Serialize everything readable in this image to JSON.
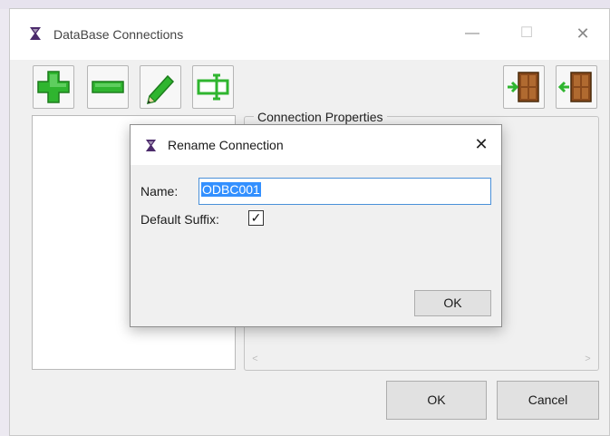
{
  "window": {
    "title": "DataBase Connections",
    "minimize_glyph": "—",
    "maximize_glyph": "☐",
    "close_glyph": "✕"
  },
  "toolbar": {
    "add_icon": "plus-icon",
    "remove_icon": "minus-icon",
    "edit_icon": "pencil-icon",
    "rename_icon": "rename-field-icon",
    "import_icon": "door-enter-icon",
    "export_icon": "door-exit-icon"
  },
  "properties": {
    "group_label": "Connection Properties",
    "scroll_left": "<",
    "scroll_right": ">"
  },
  "buttons": {
    "ok": "OK",
    "cancel": "Cancel"
  },
  "dialog": {
    "title": "Rename Connection",
    "close_glyph": "✕",
    "name_label": "Name:",
    "name_value": "ODBC001",
    "suffix_label": "Default Suffix:",
    "suffix_checked": "✓",
    "ok": "OK"
  },
  "colors": {
    "accent_green": "#2fb52f",
    "icon_purple": "#4b2a6b",
    "selection_blue": "#3390ff"
  }
}
